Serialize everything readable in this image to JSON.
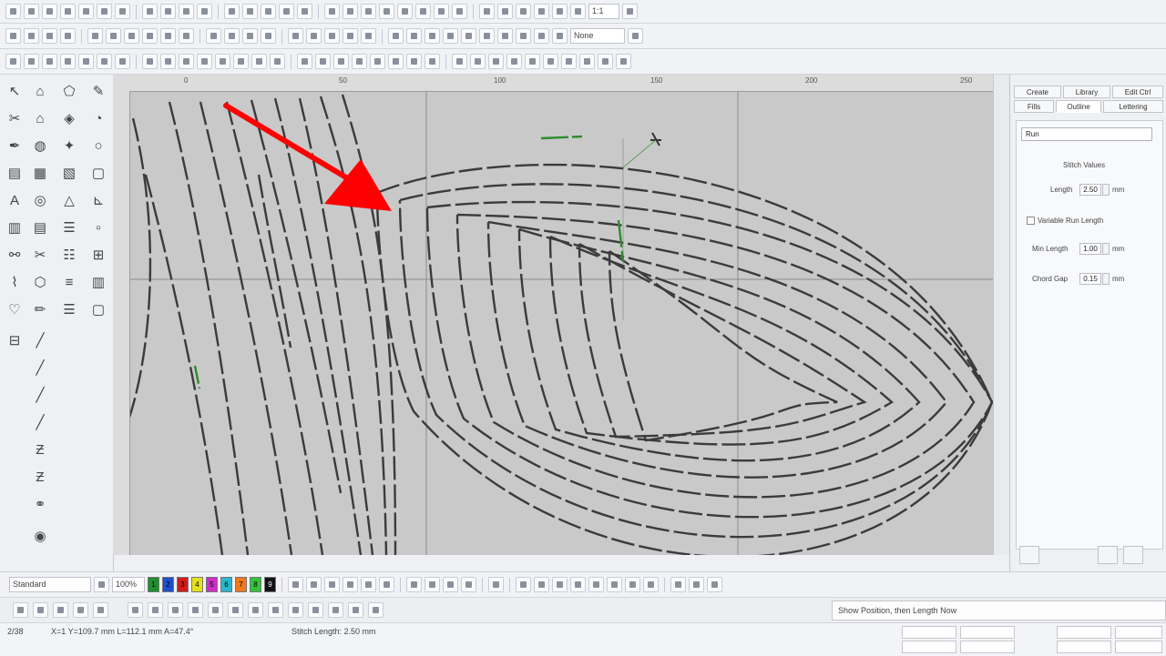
{
  "toolbar_top": {
    "zoom_value": "1:1",
    "layer_label": "None"
  },
  "panel": {
    "tabs_row1": [
      "Create",
      "Library",
      "Edit Ctrl"
    ],
    "tabs_row2": [
      "Fills",
      "Outline",
      "Lettering"
    ],
    "style_select": "Run",
    "section_title": "Stitch Values",
    "length_label": "Length",
    "length_value": "2.50",
    "length_unit": "mm",
    "checkbox_label": "Variable Run Length",
    "minlength_label": "Min Length",
    "minlength_value": "1.00",
    "minlength_unit": "mm",
    "chordgap_label": "Chord Gap",
    "chordgap_value": "0.15",
    "chordgap_unit": "mm"
  },
  "bottom": {
    "style_combo": "Standard",
    "zoom_combo": "100%",
    "swatches": [
      "1",
      "2",
      "3",
      "4",
      "5",
      "6",
      "7",
      "8",
      "9"
    ]
  },
  "tooltip": "Show Position, then Length Now",
  "status": {
    "coords": "X=1  Y=109.7 mm  L=112.1 mm  A=47.4°",
    "stitch_length": "Stitch Length: 2.50 mm",
    "left_label": "2/38"
  },
  "colors": {
    "arrow": "#ff0000",
    "canvas": "#c9c9c9",
    "stitch": "#3b3b3b",
    "stitch_green": "#2e8b2e"
  }
}
